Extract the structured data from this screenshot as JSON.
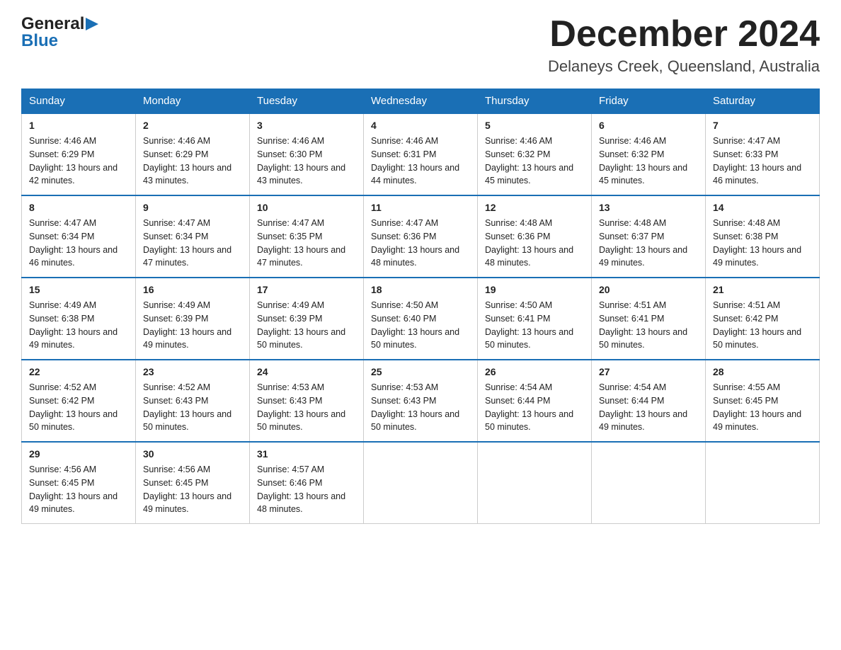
{
  "header": {
    "month_title": "December 2024",
    "location": "Delaneys Creek, Queensland, Australia",
    "logo_general": "General",
    "logo_blue": "Blue"
  },
  "days_of_week": [
    "Sunday",
    "Monday",
    "Tuesday",
    "Wednesday",
    "Thursday",
    "Friday",
    "Saturday"
  ],
  "weeks": [
    [
      {
        "day": "1",
        "sunrise": "4:46 AM",
        "sunset": "6:29 PM",
        "daylight": "13 hours and 42 minutes."
      },
      {
        "day": "2",
        "sunrise": "4:46 AM",
        "sunset": "6:29 PM",
        "daylight": "13 hours and 43 minutes."
      },
      {
        "day": "3",
        "sunrise": "4:46 AM",
        "sunset": "6:30 PM",
        "daylight": "13 hours and 43 minutes."
      },
      {
        "day": "4",
        "sunrise": "4:46 AM",
        "sunset": "6:31 PM",
        "daylight": "13 hours and 44 minutes."
      },
      {
        "day": "5",
        "sunrise": "4:46 AM",
        "sunset": "6:32 PM",
        "daylight": "13 hours and 45 minutes."
      },
      {
        "day": "6",
        "sunrise": "4:46 AM",
        "sunset": "6:32 PM",
        "daylight": "13 hours and 45 minutes."
      },
      {
        "day": "7",
        "sunrise": "4:47 AM",
        "sunset": "6:33 PM",
        "daylight": "13 hours and 46 minutes."
      }
    ],
    [
      {
        "day": "8",
        "sunrise": "4:47 AM",
        "sunset": "6:34 PM",
        "daylight": "13 hours and 46 minutes."
      },
      {
        "day": "9",
        "sunrise": "4:47 AM",
        "sunset": "6:34 PM",
        "daylight": "13 hours and 47 minutes."
      },
      {
        "day": "10",
        "sunrise": "4:47 AM",
        "sunset": "6:35 PM",
        "daylight": "13 hours and 47 minutes."
      },
      {
        "day": "11",
        "sunrise": "4:47 AM",
        "sunset": "6:36 PM",
        "daylight": "13 hours and 48 minutes."
      },
      {
        "day": "12",
        "sunrise": "4:48 AM",
        "sunset": "6:36 PM",
        "daylight": "13 hours and 48 minutes."
      },
      {
        "day": "13",
        "sunrise": "4:48 AM",
        "sunset": "6:37 PM",
        "daylight": "13 hours and 49 minutes."
      },
      {
        "day": "14",
        "sunrise": "4:48 AM",
        "sunset": "6:38 PM",
        "daylight": "13 hours and 49 minutes."
      }
    ],
    [
      {
        "day": "15",
        "sunrise": "4:49 AM",
        "sunset": "6:38 PM",
        "daylight": "13 hours and 49 minutes."
      },
      {
        "day": "16",
        "sunrise": "4:49 AM",
        "sunset": "6:39 PM",
        "daylight": "13 hours and 49 minutes."
      },
      {
        "day": "17",
        "sunrise": "4:49 AM",
        "sunset": "6:39 PM",
        "daylight": "13 hours and 50 minutes."
      },
      {
        "day": "18",
        "sunrise": "4:50 AM",
        "sunset": "6:40 PM",
        "daylight": "13 hours and 50 minutes."
      },
      {
        "day": "19",
        "sunrise": "4:50 AM",
        "sunset": "6:41 PM",
        "daylight": "13 hours and 50 minutes."
      },
      {
        "day": "20",
        "sunrise": "4:51 AM",
        "sunset": "6:41 PM",
        "daylight": "13 hours and 50 minutes."
      },
      {
        "day": "21",
        "sunrise": "4:51 AM",
        "sunset": "6:42 PM",
        "daylight": "13 hours and 50 minutes."
      }
    ],
    [
      {
        "day": "22",
        "sunrise": "4:52 AM",
        "sunset": "6:42 PM",
        "daylight": "13 hours and 50 minutes."
      },
      {
        "day": "23",
        "sunrise": "4:52 AM",
        "sunset": "6:43 PM",
        "daylight": "13 hours and 50 minutes."
      },
      {
        "day": "24",
        "sunrise": "4:53 AM",
        "sunset": "6:43 PM",
        "daylight": "13 hours and 50 minutes."
      },
      {
        "day": "25",
        "sunrise": "4:53 AM",
        "sunset": "6:43 PM",
        "daylight": "13 hours and 50 minutes."
      },
      {
        "day": "26",
        "sunrise": "4:54 AM",
        "sunset": "6:44 PM",
        "daylight": "13 hours and 50 minutes."
      },
      {
        "day": "27",
        "sunrise": "4:54 AM",
        "sunset": "6:44 PM",
        "daylight": "13 hours and 49 minutes."
      },
      {
        "day": "28",
        "sunrise": "4:55 AM",
        "sunset": "6:45 PM",
        "daylight": "13 hours and 49 minutes."
      }
    ],
    [
      {
        "day": "29",
        "sunrise": "4:56 AM",
        "sunset": "6:45 PM",
        "daylight": "13 hours and 49 minutes."
      },
      {
        "day": "30",
        "sunrise": "4:56 AM",
        "sunset": "6:45 PM",
        "daylight": "13 hours and 49 minutes."
      },
      {
        "day": "31",
        "sunrise": "4:57 AM",
        "sunset": "6:46 PM",
        "daylight": "13 hours and 48 minutes."
      },
      null,
      null,
      null,
      null
    ]
  ]
}
